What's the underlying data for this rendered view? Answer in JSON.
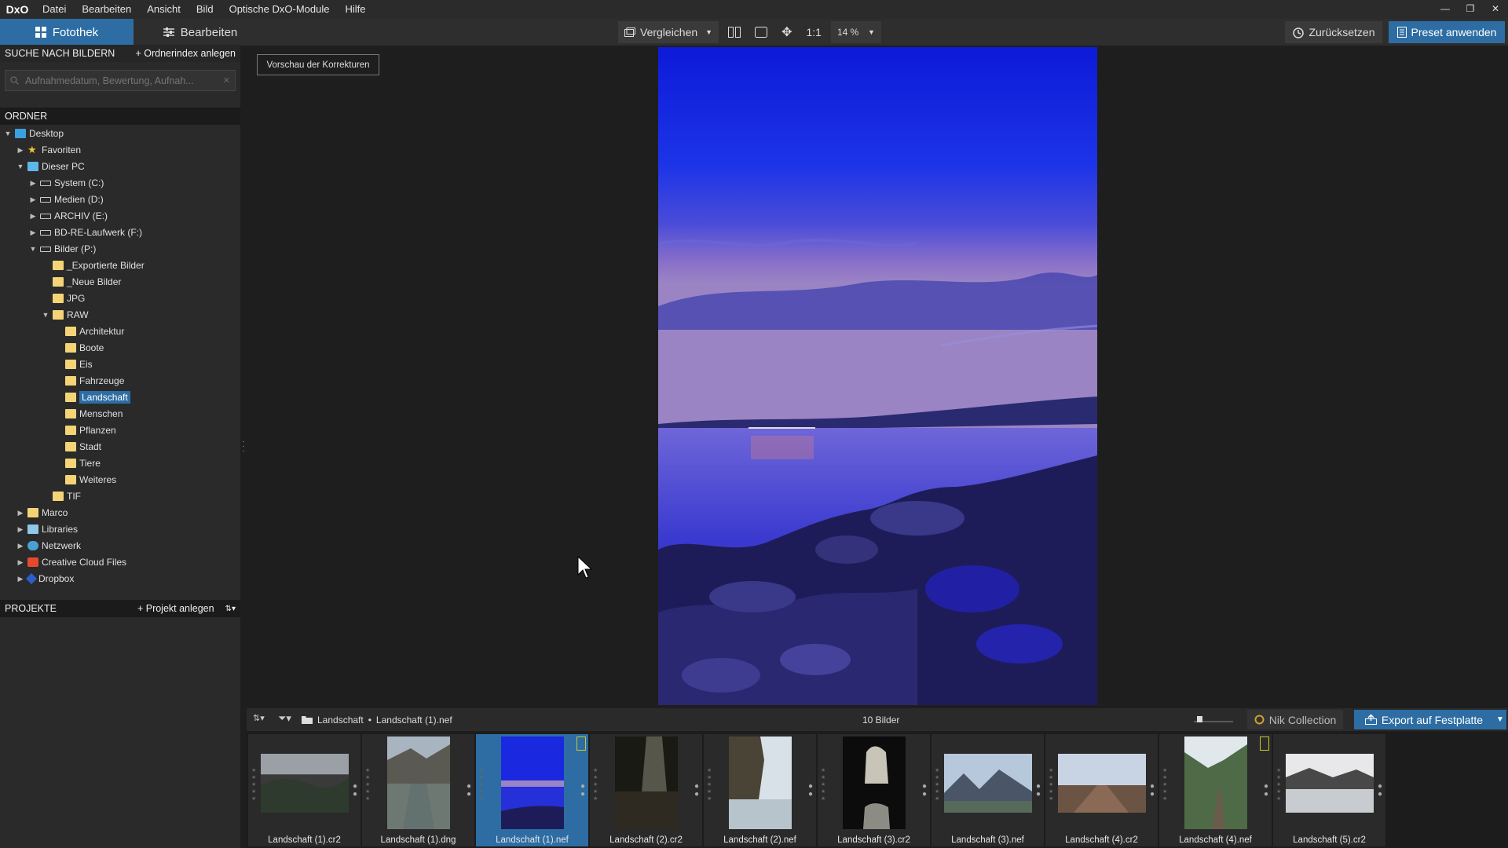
{
  "menubar": {
    "logo": "DxO",
    "items": [
      "Datei",
      "Bearbeiten",
      "Ansicht",
      "Bild",
      "Optische DxO-Module",
      "Hilfe"
    ],
    "window_controls": [
      "—",
      "❐",
      "✕"
    ]
  },
  "toolbar": {
    "tab_library": "Fotothek",
    "tab_edit": "Bearbeiten",
    "compare_label": "Vergleichen",
    "one_to_one": "1:1",
    "zoom": "14 %",
    "reset_label": "Zurücksetzen",
    "preset_label": "Preset anwenden"
  },
  "sidebar": {
    "search_header": "SUCHE NACH BILDERN",
    "index_action": "+ Ordnerindex anlegen",
    "search_placeholder": "Aufnahmedatum, Bewertung, Aufnah...",
    "folders_header": "ORDNER",
    "tree": [
      {
        "label": "Desktop",
        "depth": 0,
        "arrow": "▼",
        "icon": "desktop"
      },
      {
        "label": "Favoriten",
        "depth": 1,
        "arrow": "▶",
        "icon": "star"
      },
      {
        "label": "Dieser PC",
        "depth": 1,
        "arrow": "▼",
        "icon": "pc"
      },
      {
        "label": "System (C:)",
        "depth": 2,
        "arrow": "▶",
        "icon": "drive"
      },
      {
        "label": "Medien (D:)",
        "depth": 2,
        "arrow": "▶",
        "icon": "drive"
      },
      {
        "label": "ARCHIV (E:)",
        "depth": 2,
        "arrow": "▶",
        "icon": "drive"
      },
      {
        "label": "BD-RE-Laufwerk (F:)",
        "depth": 2,
        "arrow": "▶",
        "icon": "drive"
      },
      {
        "label": "Bilder (P:)",
        "depth": 2,
        "arrow": "▼",
        "icon": "drive"
      },
      {
        "label": "_Exportierte Bilder",
        "depth": 3,
        "arrow": "",
        "icon": "folder"
      },
      {
        "label": "_Neue Bilder",
        "depth": 3,
        "arrow": "",
        "icon": "folder"
      },
      {
        "label": "JPG",
        "depth": 3,
        "arrow": "",
        "icon": "folder"
      },
      {
        "label": "RAW",
        "depth": 3,
        "arrow": "▼",
        "icon": "folder"
      },
      {
        "label": "Architektur",
        "depth": 4,
        "arrow": "",
        "icon": "folder"
      },
      {
        "label": "Boote",
        "depth": 4,
        "arrow": "",
        "icon": "folder"
      },
      {
        "label": "Eis",
        "depth": 4,
        "arrow": "",
        "icon": "folder"
      },
      {
        "label": "Fahrzeuge",
        "depth": 4,
        "arrow": "",
        "icon": "folder"
      },
      {
        "label": "Landschaft",
        "depth": 4,
        "arrow": "",
        "icon": "folder",
        "selected": true
      },
      {
        "label": "Menschen",
        "depth": 4,
        "arrow": "",
        "icon": "folder"
      },
      {
        "label": "Pflanzen",
        "depth": 4,
        "arrow": "",
        "icon": "folder"
      },
      {
        "label": "Stadt",
        "depth": 4,
        "arrow": "",
        "icon": "folder"
      },
      {
        "label": "Tiere",
        "depth": 4,
        "arrow": "",
        "icon": "folder"
      },
      {
        "label": "Weiteres",
        "depth": 4,
        "arrow": "",
        "icon": "folder"
      },
      {
        "label": "TIF",
        "depth": 3,
        "arrow": "",
        "icon": "folder"
      },
      {
        "label": "Marco",
        "depth": 1,
        "arrow": "▶",
        "icon": "folder"
      },
      {
        "label": "Libraries",
        "depth": 1,
        "arrow": "▶",
        "icon": "lib"
      },
      {
        "label": "Netzwerk",
        "depth": 1,
        "arrow": "▶",
        "icon": "net"
      },
      {
        "label": "Creative Cloud Files",
        "depth": 1,
        "arrow": "▶",
        "icon": "cc"
      },
      {
        "label": "Dropbox",
        "depth": 1,
        "arrow": "▶",
        "icon": "dropbox"
      }
    ],
    "projects_header": "PROJEKTE",
    "project_action": "+ Projekt anlegen"
  },
  "viewer": {
    "preview_button": "Vorschau der Korrekturen"
  },
  "filmstrip_bar": {
    "folder": "Landschaft",
    "separator": "•",
    "file": "Landschaft (1).nef",
    "count": "10 Bilder",
    "nik_label": "Nik Collection",
    "export_label": "Export auf Festplatte"
  },
  "thumbnails": [
    {
      "label": "Landschaft (1).cr2",
      "scene": "mountain-dark",
      "orient": "land"
    },
    {
      "label": "Landschaft (1).dng",
      "scene": "river",
      "orient": "port"
    },
    {
      "label": "Landschaft (1).nef",
      "scene": "blue-lake",
      "orient": "port",
      "selected": true,
      "badge": true
    },
    {
      "label": "Landschaft (2).cr2",
      "scene": "forest-light",
      "orient": "port"
    },
    {
      "label": "Landschaft (2).nef",
      "scene": "rock-water",
      "orient": "port"
    },
    {
      "label": "Landschaft (3).cr2",
      "scene": "cave",
      "orient": "port"
    },
    {
      "label": "Landschaft (3).nef",
      "scene": "mountains-blue",
      "orient": "land"
    },
    {
      "label": "Landschaft (4).cr2",
      "scene": "road-sky",
      "orient": "land"
    },
    {
      "label": "Landschaft (4).nef",
      "scene": "valley-green",
      "orient": "port",
      "badge": true
    },
    {
      "label": "Landschaft (5).cr2",
      "scene": "snow-lake",
      "orient": "land"
    }
  ],
  "colors": {
    "accent": "#2d6da3",
    "panel": "#2a2a2a",
    "background": "#1e1e1e"
  }
}
